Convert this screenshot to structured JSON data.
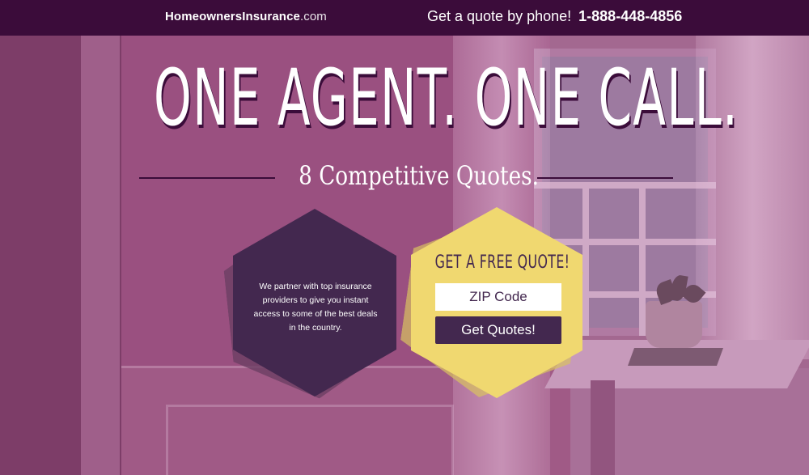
{
  "header": {
    "logo_strong": "HomeownersInsurance",
    "logo_light": ".com",
    "phone_label": "Get a quote by phone!",
    "phone_number": "1-888-448-4856"
  },
  "hero": {
    "headline": "ONE AGENT. ONE CALL.",
    "subheadline": "8 Competitive Quotes."
  },
  "info": {
    "text": "We partner with top insurance providers to give you instant access to some of the best deals in the country."
  },
  "quote_form": {
    "title": "GET A FREE QUOTE!",
    "zip_placeholder": "ZIP Code",
    "submit_label": "Get Quotes!"
  },
  "colors": {
    "topbar": "#3b0c3a",
    "dark_hex": "#43284f",
    "yellow_hex": "#f0d870",
    "overlay": "#8a4a78"
  }
}
